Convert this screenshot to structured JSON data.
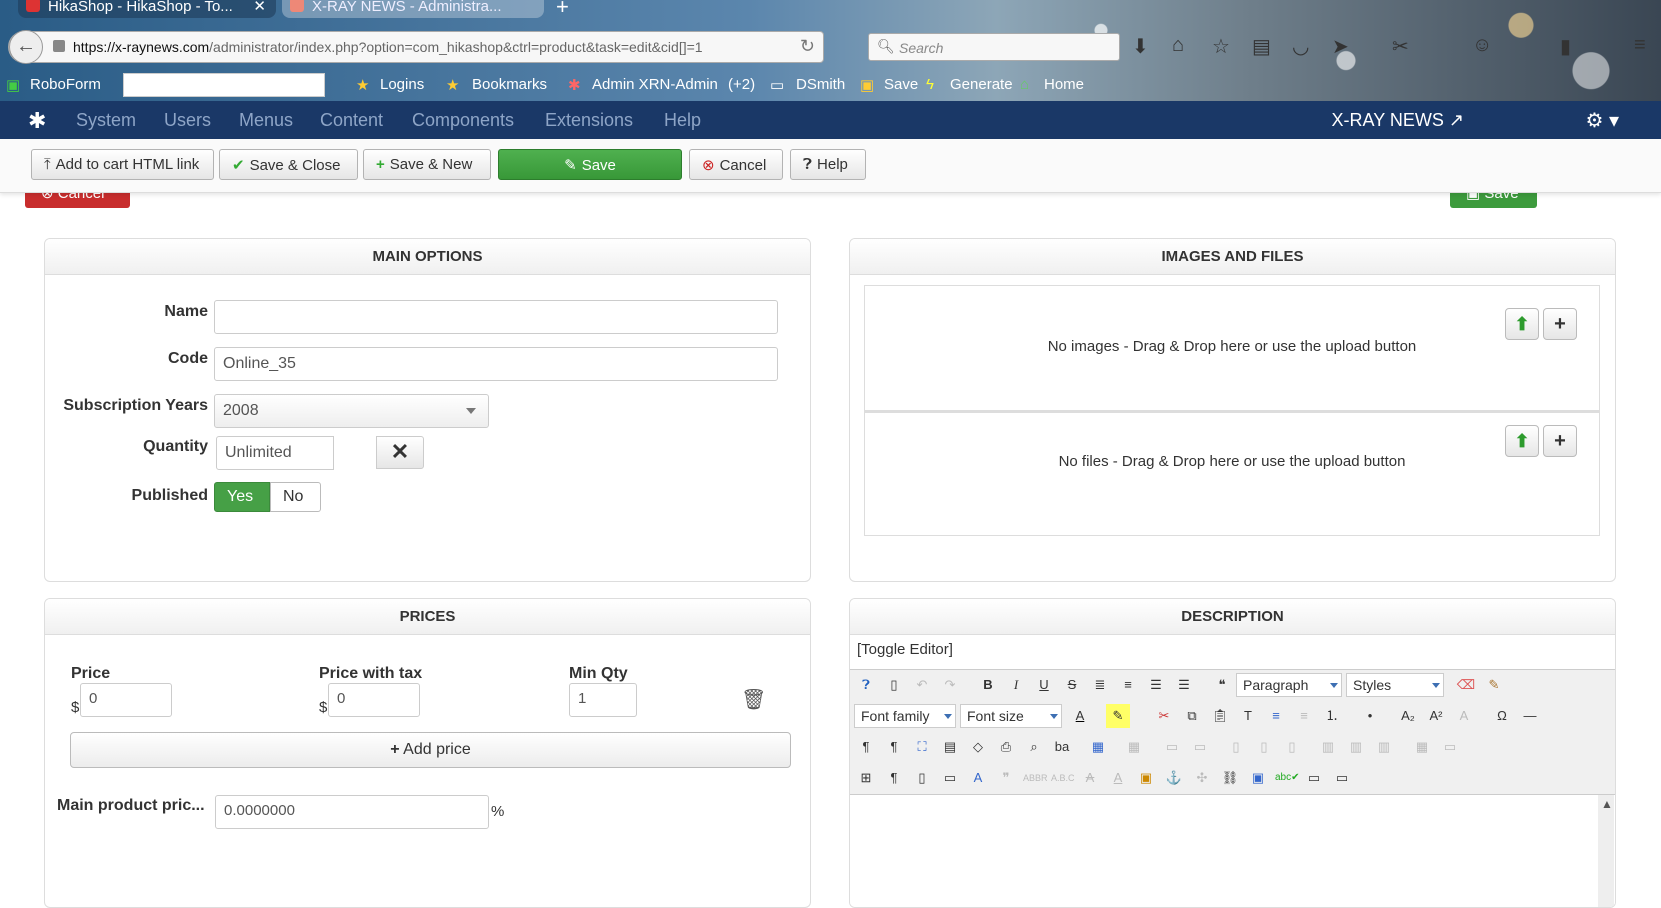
{
  "browser": {
    "tabs": [
      {
        "label": "HikaShop - HikaShop - To..."
      },
      {
        "label": "X-RAY NEWS - Administra..."
      }
    ],
    "url_domain": "https://x-raynews.com",
    "url_path": "/administrator/index.php?option=com_hikashop&ctrl=product&task=edit&cid[]=1",
    "search_placeholder": "Search",
    "bookmarks": {
      "roboform": "RoboForm",
      "logins": "Logins",
      "bookmarks": "Bookmarks",
      "admin": "Admin XRN-Admin",
      "admin_badge": "(+2)",
      "dsmith": "DSmith",
      "save": "Save",
      "generate": "Generate",
      "home": "Home"
    }
  },
  "navbar": {
    "items": [
      "System",
      "Users",
      "Menus",
      "Content",
      "Components",
      "Extensions",
      "Help"
    ],
    "site_name": "X-RAY NEWS"
  },
  "toolbar": {
    "add_to_cart": "Add to cart HTML link",
    "save_close": "Save & Close",
    "save_new": "Save & New",
    "save": "Save",
    "cancel": "Cancel",
    "help": "Help"
  },
  "ghost": {
    "cancel": "Cancel",
    "save": "Save"
  },
  "main_options": {
    "title": "MAIN OPTIONS",
    "name_label": "Name",
    "name_value": "",
    "code_label": "Code",
    "code_value": "Online_35",
    "years_label": "Subscription Years",
    "years_value": "2008",
    "quantity_label": "Quantity",
    "quantity_value": "Unlimited",
    "published_label": "Published",
    "published_yes": "Yes",
    "published_no": "No"
  },
  "images_files": {
    "title": "IMAGES AND FILES",
    "images_text": "No images - Drag & Drop here or use the upload button",
    "files_text": "No files - Drag & Drop here or use the upload button"
  },
  "prices": {
    "title": "PRICES",
    "price_label": "Price",
    "price_tax_label": "Price with tax",
    "min_qty_label": "Min Qty",
    "currency": "$",
    "price_value": "0",
    "price_tax_value": "0",
    "min_qty_value": "1",
    "add_price": "Add price",
    "main_price_label": "Main product pric...",
    "main_price_value": "0.0000000",
    "percent": "%"
  },
  "description": {
    "title": "DESCRIPTION",
    "toggle_editor": "[Toggle Editor]",
    "format_select": "Paragraph",
    "styles_select": "Styles",
    "font_family": "Font family",
    "font_size": "Font size"
  },
  "colors": {
    "navbar": "#1a3867",
    "save_green": "#46a046",
    "cancel_red": "#c82d2d"
  }
}
